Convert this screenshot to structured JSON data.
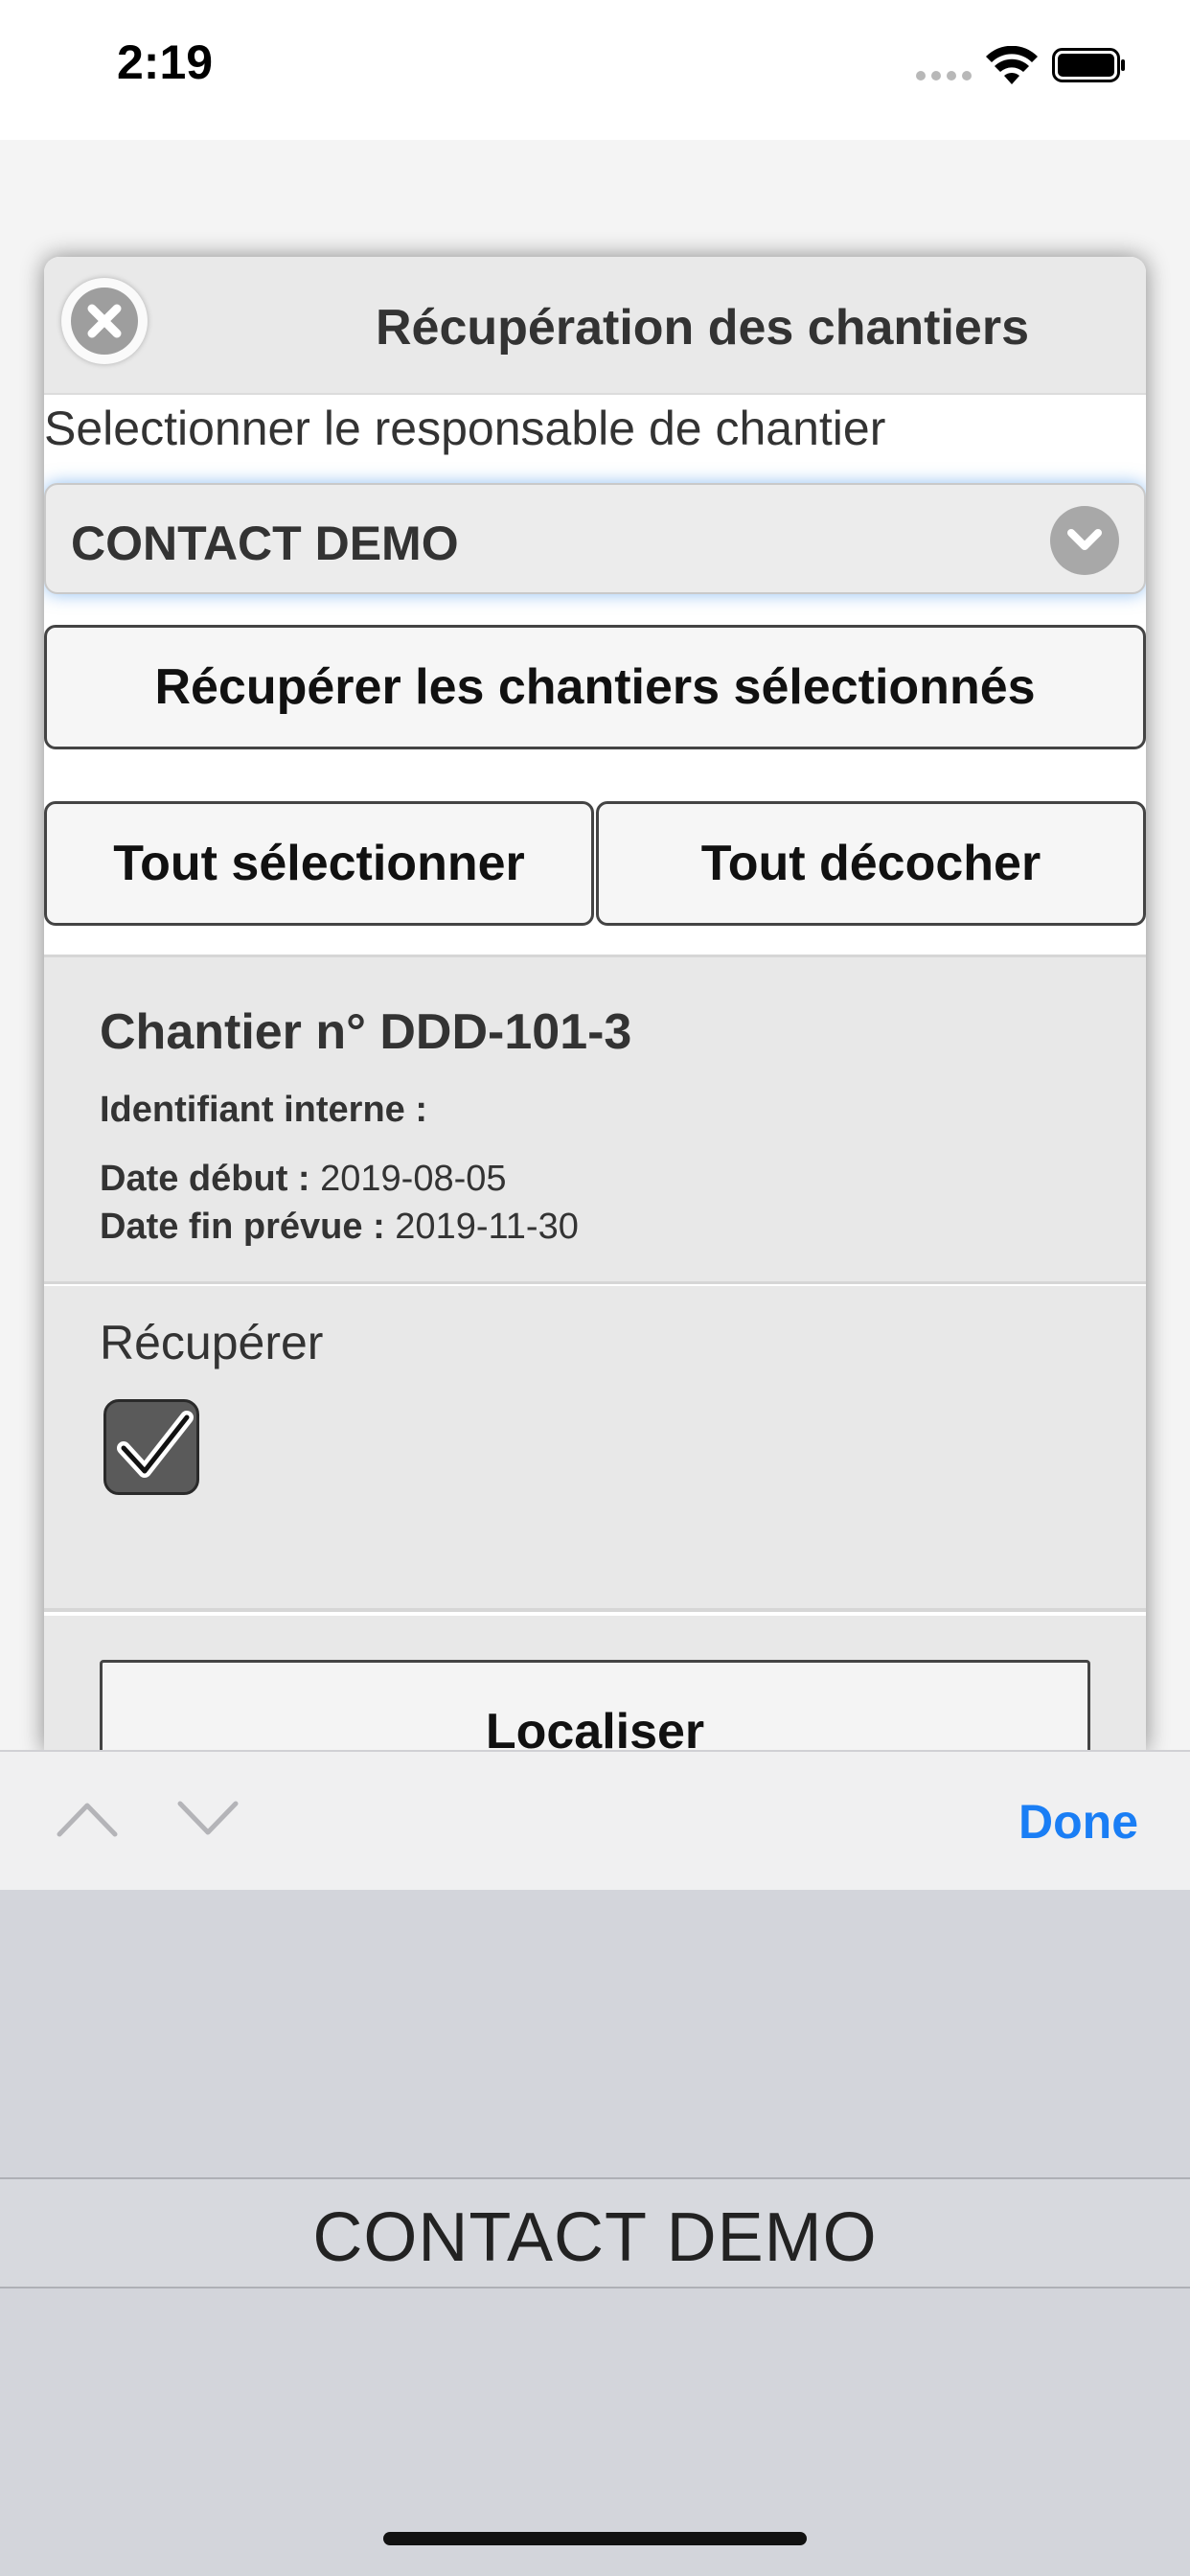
{
  "status_bar": {
    "time": "2:19",
    "icons": [
      "signal-dots-icon",
      "wifi-icon",
      "battery-icon"
    ]
  },
  "dialog": {
    "title": "Récupération des chantiers",
    "close_icon": "close-icon",
    "select_label": "Selectionner le responsable de chantier",
    "select_value": "CONTACT DEMO",
    "buttons": {
      "fetch_selected": "Récupérer les chantiers sélectionnés",
      "select_all": "Tout sélectionner",
      "uncheck_all": "Tout décocher",
      "locate": "Localiser"
    },
    "chantier": {
      "title": "Chantier n° DDD-101-3",
      "internal_id_label": "Identifiant interne :",
      "internal_id_value": "",
      "start_label": "Date début :",
      "start_value": "2019-08-05",
      "end_label": "Date fin prévue :",
      "end_value": "2019-11-30",
      "fetch_label": "Récupérer",
      "fetch_checked": true
    }
  },
  "keyboard_bar": {
    "done_label": "Done"
  },
  "picker": {
    "selected_option": "CONTACT DEMO"
  },
  "colors": {
    "accent": "#1a7ef5",
    "focus_glow": "#388ce6"
  }
}
